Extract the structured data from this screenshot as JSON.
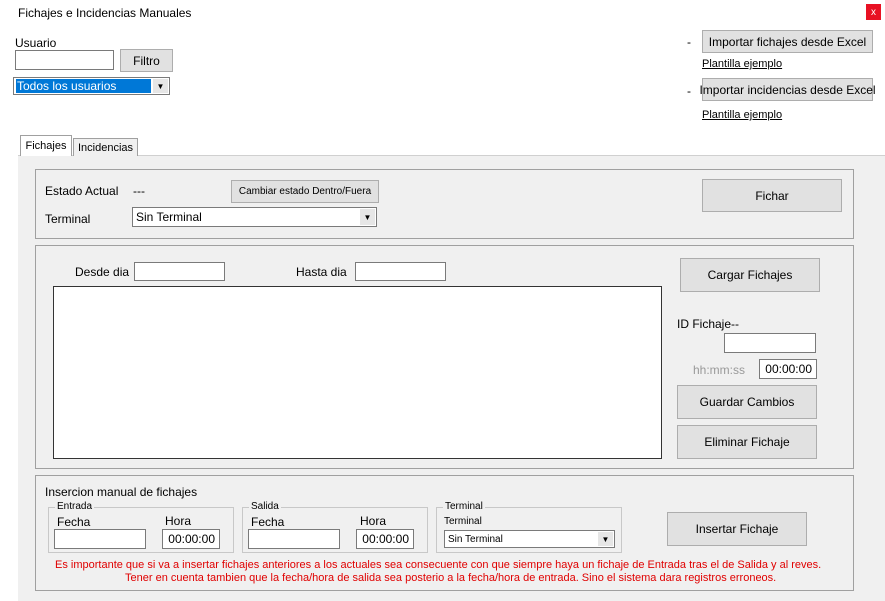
{
  "window": {
    "title": "Fichajes e Incidencias Manuales",
    "close_label": "x"
  },
  "top": {
    "usuario_label": "Usuario",
    "usuario_value": "",
    "filtro_button": "Filtro",
    "usuarios_select": "Todos los usuarios",
    "dash1": "-",
    "import_fichajes_button": "Importar fichajes desde Excel",
    "plantilla1": "Plantilla ejemplo",
    "dash2": "-",
    "import_incidencias_button": "Importar incidencias desde Excel",
    "plantilla2": "Plantilla ejemplo"
  },
  "tabs": [
    {
      "label": "Fichajes"
    },
    {
      "label": "Incidencias"
    }
  ],
  "estado": {
    "estado_label": "Estado Actual",
    "estado_value": "---",
    "cambiar_button": "Cambiar estado Dentro/Fuera",
    "terminal_label": "Terminal",
    "terminal_select": "Sin Terminal",
    "fichar_button": "Fichar"
  },
  "listado": {
    "desde_label": "Desde dia",
    "desde_value": "",
    "hasta_label": "Hasta dia",
    "hasta_value": "",
    "cargar_button": "Cargar Fichajes",
    "id_label": "ID Fichaje",
    "id_value": "--",
    "id_input": "",
    "hhmmss_label": "hh:mm:ss",
    "hora_value": "00:00:00",
    "guardar_button": "Guardar Cambios",
    "eliminar_button": "Eliminar Fichaje"
  },
  "insercion": {
    "title": "Insercion manual de fichajes",
    "entrada_group": "Entrada",
    "entrada_fecha_label": "Fecha",
    "entrada_fecha_value": "",
    "entrada_hora_label": "Hora",
    "entrada_hora_value": "00:00:00",
    "salida_group": "Salida",
    "salida_fecha_label": "Fecha",
    "salida_fecha_value": "",
    "salida_hora_label": "Hora",
    "salida_hora_value": "00:00:00",
    "terminal_group": "Terminal",
    "terminal_label": "Terminal",
    "terminal_select": "Sin Terminal",
    "insertar_button": "Insertar Fichaje",
    "warning1": "Es importante que si va a insertar fichajes anteriores a los actuales sea consecuente con que siempre haya un fichaje de Entrada tras el de Salida y al reves.",
    "warning2": "Tener en cuenta tambien que la fecha/hora de salida sea posterio a la fecha/hora de entrada. Sino el sistema dara registros erroneos."
  },
  "colors": {
    "close_red": "#e81123",
    "warning_red": "#e00000",
    "selection_blue": "#0078d7"
  }
}
